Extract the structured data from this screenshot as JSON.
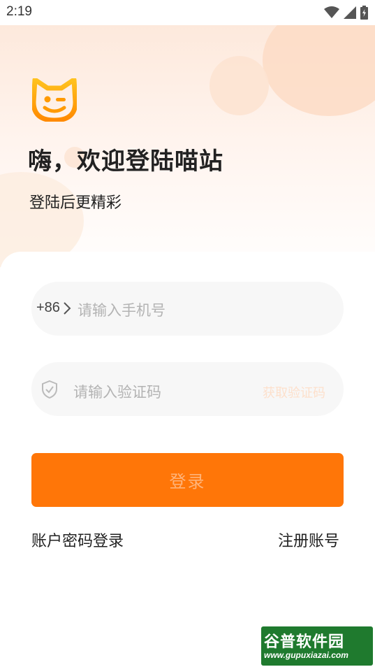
{
  "status_bar": {
    "time": "2:19",
    "icons": [
      "wifi-icon",
      "cell-signal-icon",
      "battery-icon"
    ]
  },
  "header": {
    "logo_icon": "cat-face-logo-icon",
    "title": "嗨，欢迎登陆喵站",
    "subtitle": "登陆后更精彩"
  },
  "form": {
    "phone": {
      "country_code": "+86",
      "placeholder": "请输入手机号",
      "value": ""
    },
    "code": {
      "icon": "shield-check-icon",
      "placeholder": "请输入验证码",
      "value": "",
      "get_code_label": "获取验证码"
    },
    "login_label": "登录",
    "password_login_label": "账户密码登录",
    "register_label": "注册账号"
  },
  "watermark": {
    "title": "谷普软件园",
    "url": "www.gupuxiazai.com"
  },
  "colors": {
    "accent": "#ff7608",
    "accent_light": "#ffb47a",
    "field_bg": "#f7f7f7",
    "placeholder": "#b3b3b3",
    "hero_tint": "#fde9dc"
  }
}
